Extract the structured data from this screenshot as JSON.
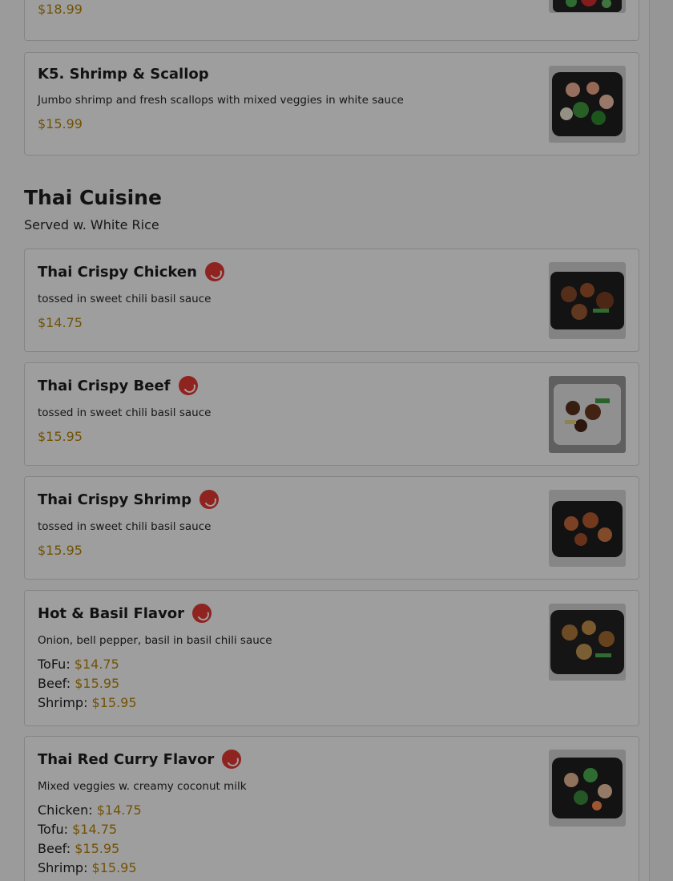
{
  "menu": {
    "top_card": {
      "price": "$18.99"
    },
    "k5": {
      "name": "K5. Shrimp & Scallop",
      "desc": "Jumbo shrimp and fresh scallops with mixed veggies in white sauce",
      "price": "$15.99"
    },
    "section": {
      "title": "Thai Cuisine",
      "subtitle": "Served w. White Rice"
    },
    "items": [
      {
        "name": "Thai Crispy Chicken",
        "desc": "tossed in sweet chili basil sauce",
        "price": "$14.75"
      },
      {
        "name": "Thai Crispy Beef",
        "desc": "tossed in sweet chili basil sauce",
        "price": "$15.95"
      },
      {
        "name": "Thai Crispy Shrimp",
        "desc": "tossed in sweet chili basil sauce",
        "price": "$15.95"
      },
      {
        "name": "Hot & Basil Flavor",
        "desc": "Onion, bell pepper, basil in basil chili sauce",
        "options": [
          {
            "label": "ToFu:",
            "price": "$14.75"
          },
          {
            "label": "Beef:",
            "price": "$15.95"
          },
          {
            "label": "Shrimp:",
            "price": "$15.95"
          }
        ]
      },
      {
        "name": "Thai Red Curry Flavor",
        "desc": "Mixed veggies w. creamy coconut milk",
        "options": [
          {
            "label": "Chicken:",
            "price": "$14.75"
          },
          {
            "label": "Tofu:",
            "price": "$14.75"
          },
          {
            "label": "Beef:",
            "price": "$15.95"
          },
          {
            "label": "Shrimp:",
            "price": "$15.95"
          }
        ]
      }
    ],
    "icons": {
      "spicy": "chili-pepper-icon"
    },
    "colors": {
      "price": "#b8860b",
      "spicy": "#e53935"
    }
  }
}
